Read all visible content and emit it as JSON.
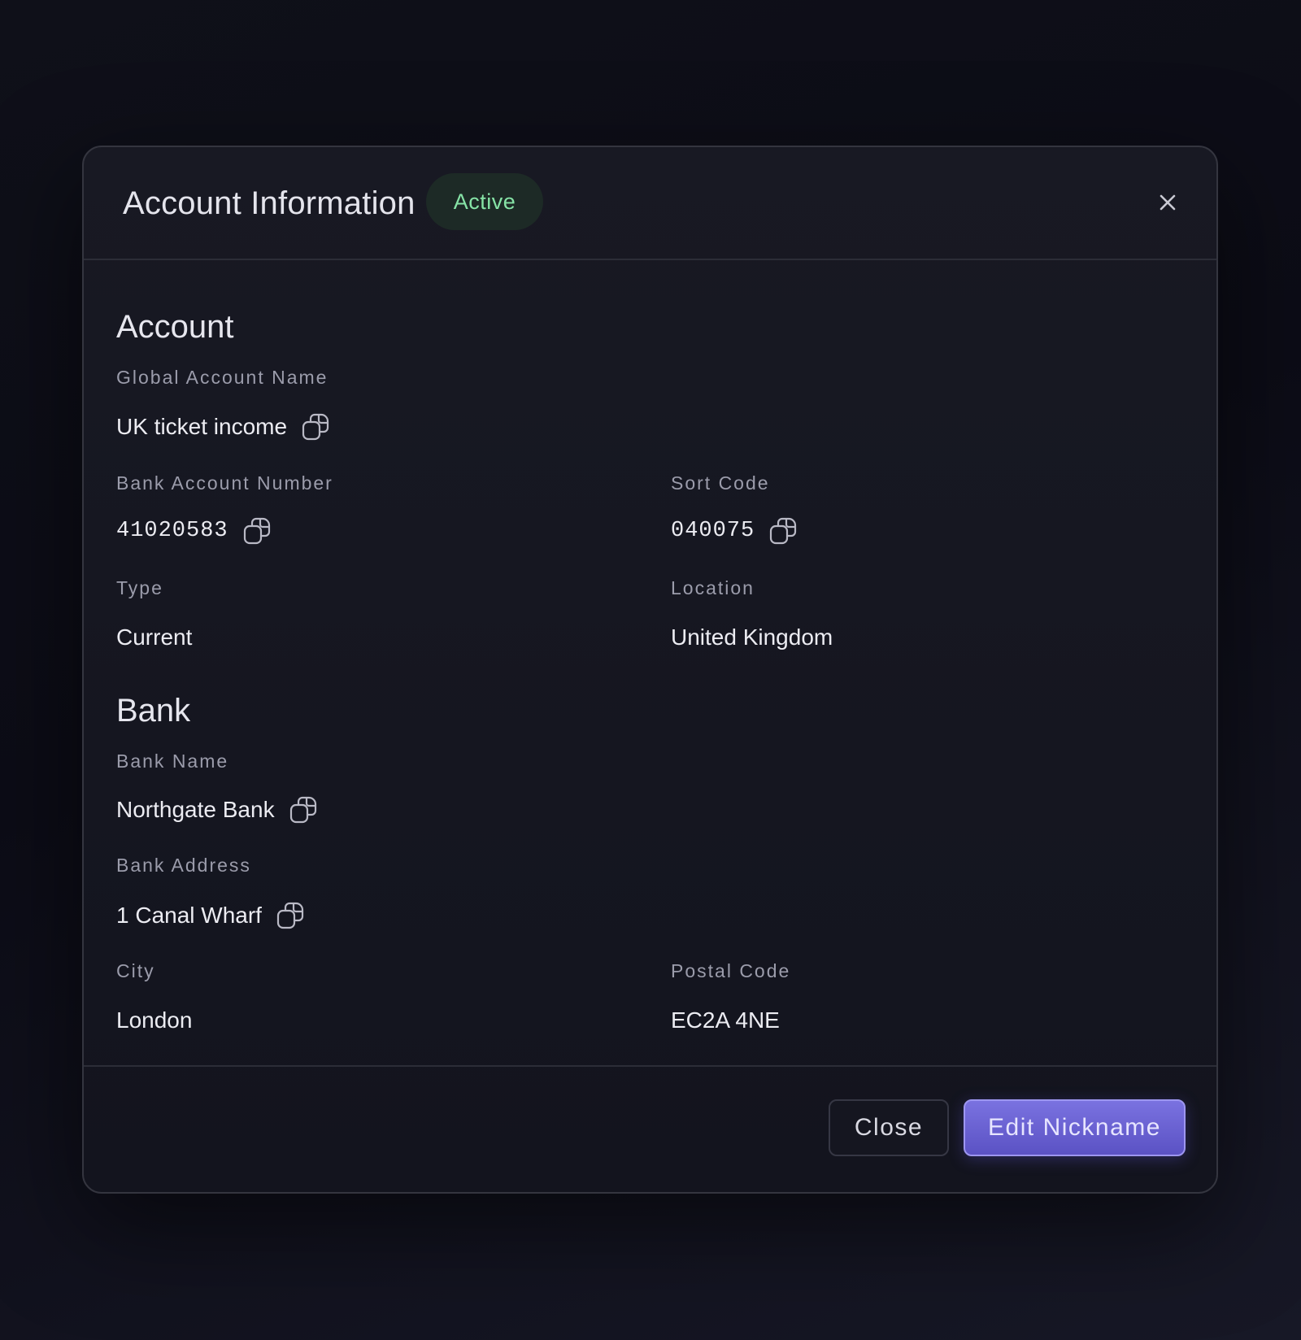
{
  "modal": {
    "title": "Account Information",
    "status": "Active",
    "close_icon": "close-icon"
  },
  "account": {
    "section_title": "Account",
    "global_account_name_label": "Global Account Name",
    "global_account_name": "UK ticket income",
    "bank_account_number_label": "Bank Account Number",
    "bank_account_number": "41020583",
    "sort_code_label": "Sort Code",
    "sort_code": "040075",
    "type_label": "Type",
    "type": "Current",
    "location_label": "Location",
    "location": "United Kingdom"
  },
  "bank": {
    "section_title": "Bank",
    "bank_name_label": "Bank Name",
    "bank_name": "Northgate Bank",
    "bank_address_label": "Bank Address",
    "bank_address": "1 Canal Wharf",
    "city_label": "City",
    "city": "London",
    "postal_code_label": "Postal Code",
    "postal_code": "EC2A 4NE"
  },
  "footer": {
    "close_label": "Close",
    "edit_label": "Edit Nickname"
  },
  "icons": {
    "copy": "copy-icon"
  },
  "colors": {
    "status_text": "#86e3a6",
    "status_bg": "#1d2a26",
    "primary": "#6a62d6"
  }
}
